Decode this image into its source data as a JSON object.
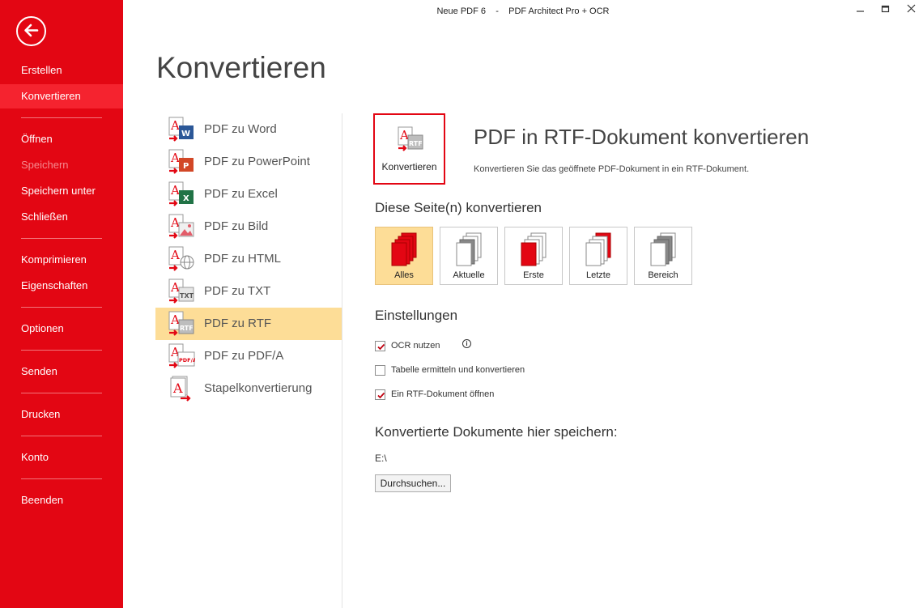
{
  "window": {
    "title": "Neue PDF 6    -    PDF Architect Pro + OCR"
  },
  "sidebar": {
    "items": [
      {
        "label": "Erstellen"
      },
      {
        "label": "Konvertieren"
      },
      {
        "label": "Öffnen"
      },
      {
        "label": "Speichern"
      },
      {
        "label": "Speichern unter"
      },
      {
        "label": "Schließen"
      },
      {
        "label": "Komprimieren"
      },
      {
        "label": "Eigenschaften"
      },
      {
        "label": "Optionen"
      },
      {
        "label": "Senden"
      },
      {
        "label": "Drucken"
      },
      {
        "label": "Konto"
      },
      {
        "label": "Beenden"
      }
    ],
    "active": "Konvertieren",
    "disabled": "Speichern"
  },
  "page": {
    "title": "Konvertieren"
  },
  "convert_list": {
    "items": [
      {
        "label": "PDF zu Word"
      },
      {
        "label": "PDF zu PowerPoint"
      },
      {
        "label": "PDF zu Excel"
      },
      {
        "label": "PDF zu Bild"
      },
      {
        "label": "PDF zu HTML"
      },
      {
        "label": "PDF zu TXT"
      },
      {
        "label": "PDF zu RTF"
      },
      {
        "label": "PDF zu PDF/A"
      },
      {
        "label": "Stapelkonvertierung"
      }
    ],
    "selected": "PDF zu RTF"
  },
  "detail": {
    "convert_button": "Konvertieren",
    "heading": "PDF in RTF-Dokument konvertieren",
    "description": "Konvertieren Sie das geöffnete PDF-Dokument in ein RTF-Dokument.",
    "pages_section": "Diese Seite(n) konvertieren",
    "page_options": [
      {
        "label": "Alles"
      },
      {
        "label": "Aktuelle"
      },
      {
        "label": "Erste"
      },
      {
        "label": "Letzte"
      },
      {
        "label": "Bereich"
      }
    ],
    "selected_page_option": "Alles",
    "settings_section": "Einstellungen",
    "settings": [
      {
        "label": "OCR nutzen",
        "checked": true
      },
      {
        "label": "Tabelle ermitteln und konvertieren",
        "checked": false
      },
      {
        "label": "Ein RTF-Dokument öffnen",
        "checked": true
      }
    ],
    "save_section": "Konvertierte Dokumente hier speichern:",
    "save_path": "E:\\",
    "browse_button": "Durchsuchen..."
  },
  "colors": {
    "brand_red": "#e30613",
    "selection": "#fddd97"
  }
}
